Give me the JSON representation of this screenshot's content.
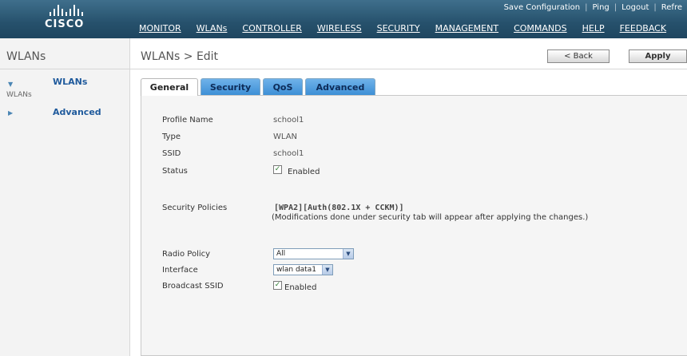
{
  "header": {
    "logo_text": "CISCO",
    "utility_links": [
      "Save Configuration",
      "Ping",
      "Logout",
      "Refre"
    ],
    "menu": [
      "MONITOR",
      "WLANs",
      "CONTROLLER",
      "WIRELESS",
      "SECURITY",
      "MANAGEMENT",
      "COMMANDS",
      "HELP",
      "FEEDBACK"
    ],
    "active_menu": "WLANs"
  },
  "sidebar": {
    "title": "WLANs",
    "items": [
      {
        "label": "WLANs",
        "sub": "WLANs",
        "expanded": true
      },
      {
        "label": "Advanced",
        "expanded": false
      }
    ]
  },
  "page": {
    "title": "WLANs > Edit",
    "back_label": "< Back",
    "apply_label": "Apply"
  },
  "tabs": [
    "General",
    "Security",
    "QoS",
    "Advanced"
  ],
  "active_tab": "General",
  "form": {
    "profile_name_label": "Profile Name",
    "profile_name": "school1",
    "type_label": "Type",
    "type": "WLAN",
    "ssid_label": "SSID",
    "ssid": "school1",
    "status_label": "Status",
    "status_checked": true,
    "status_text": "Enabled",
    "security_policies_label": "Security Policies",
    "security_policies": "[WPA2][Auth(802.1X + CCKM)]",
    "security_note": "(Modifications done under security tab will appear after applying the changes.)",
    "radio_policy_label": "Radio Policy",
    "radio_policy": "All",
    "interface_label": "Interface",
    "interface": "wlan data1",
    "broadcast_ssid_label": "Broadcast SSID",
    "broadcast_ssid_checked": true,
    "broadcast_ssid_text": "Enabled"
  },
  "colors": {
    "header_bg": "#26516c",
    "tab_bg": "#3d8fd6",
    "link": "#1f5a9c"
  },
  "icons": {
    "check": "✓",
    "expanded": "▼",
    "collapsed": "▶",
    "select_arrow": "▼"
  }
}
